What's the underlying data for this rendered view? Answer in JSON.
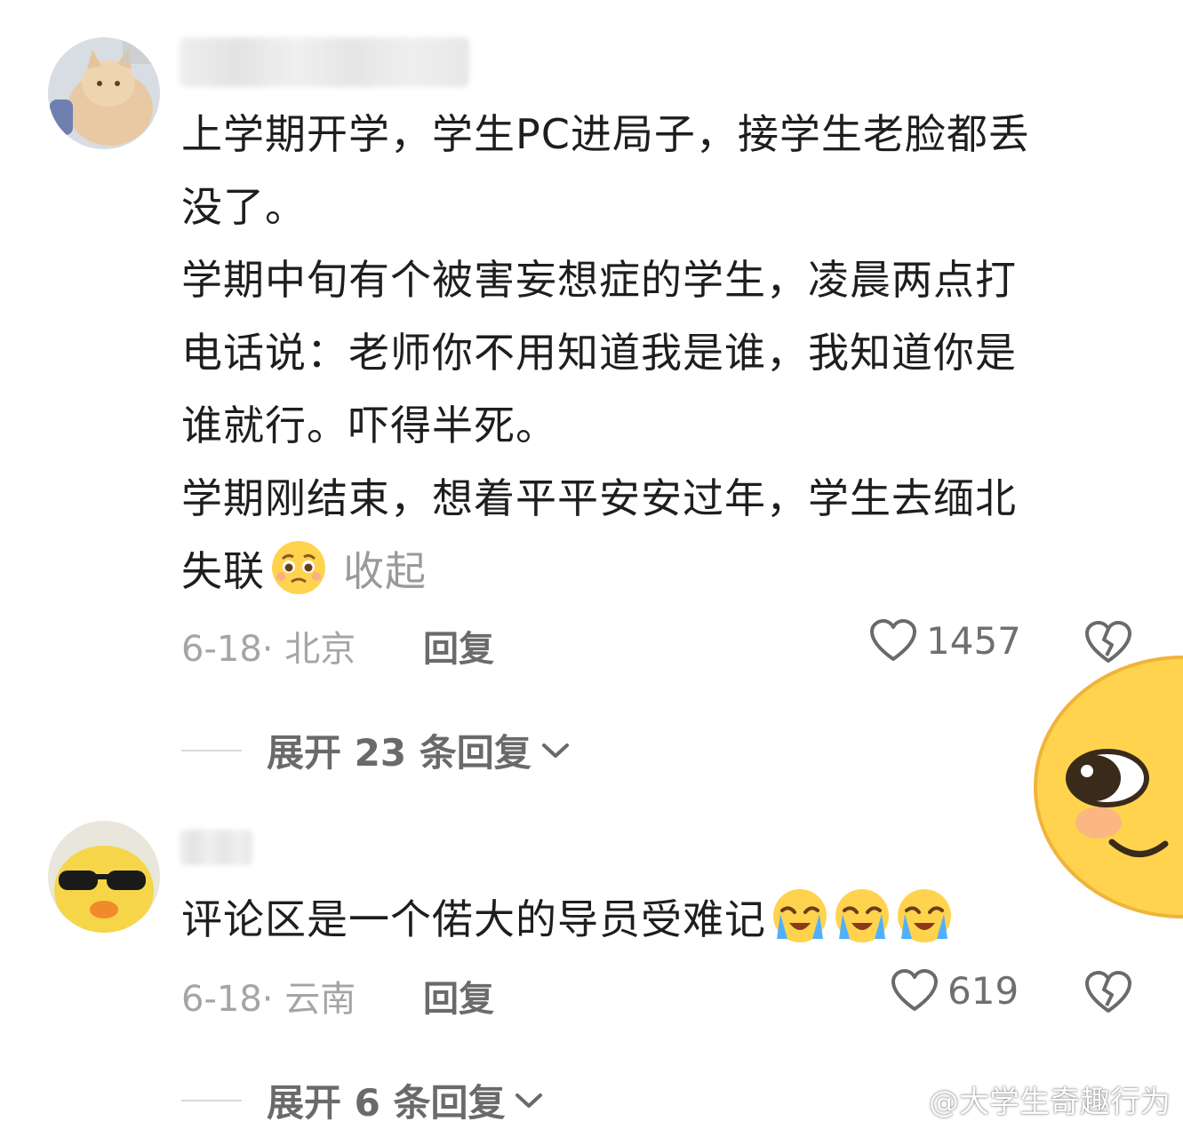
{
  "comments": [
    {
      "lines": [
        "上学期开学，学生PC进局子，接学生老脸都丢",
        "没了。",
        "学期中旬有个被害妄想症的学生，凌晨两点打",
        "电话说：老师你不用知道我是谁，我知道你是",
        "谁就行。吓得半死。",
        "学期刚结束，想着平平安安过年，学生去缅北"
      ],
      "last_line": "失联",
      "collapse": "收起",
      "meta": "6-18· 北京",
      "reply": "回复",
      "likes": "1457",
      "expand": "展开 23 条回复"
    },
    {
      "text": "评论区是一个偌大的导员受难记",
      "meta": "6-18· 云南",
      "reply": "回复",
      "likes": "619",
      "expand": "展开 6 条回复"
    }
  ],
  "watermark": "@大学生奇趣行为",
  "icons": {
    "like": "heart-outline-icon",
    "dislike": "broken-heart-icon",
    "expand": "chevron-down-icon",
    "watermark": "weibo-logo-icon"
  },
  "colors": {
    "text": "#1e1e1e",
    "meta": "#a5a5a5",
    "secondary": "#6b6b6b",
    "emoji_yellow": "#ffd34e"
  }
}
